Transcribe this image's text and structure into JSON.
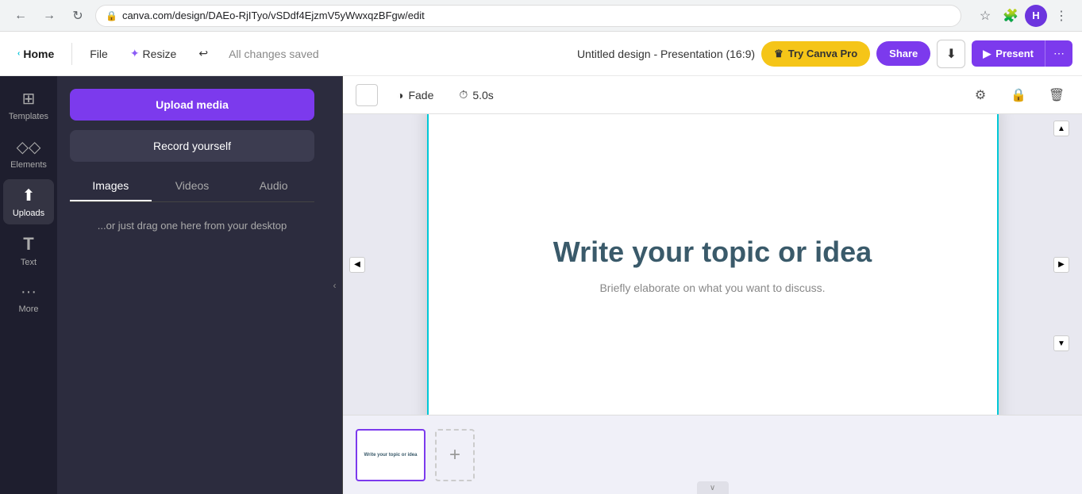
{
  "browser": {
    "back_label": "←",
    "forward_label": "→",
    "reload_label": "↻",
    "url": "canva.com/design/DAEo-RjITyo/vSDdf4EjzmV5yWwxqzBFgw/edit",
    "star_label": "☆",
    "extensions_label": "🧩",
    "avatar_label": "H",
    "menu_label": "⋮"
  },
  "header": {
    "home_label": "Home",
    "home_chevron": "‹",
    "file_label": "File",
    "magic_icon": "✦",
    "resize_label": "Resize",
    "undo_label": "↩",
    "saved_text": "All changes saved",
    "title": "Untitled design - Presentation (16:9)",
    "crown_icon": "♛",
    "try_pro_label": "Try Canva Pro",
    "share_label": "Share",
    "download_icon": "⬇",
    "present_icon": "▶",
    "present_label": "Present",
    "more_label": "⋯"
  },
  "sidebar": {
    "items": [
      {
        "id": "templates",
        "icon": "⊞",
        "label": "Templates"
      },
      {
        "id": "elements",
        "icon": "◇",
        "label": "Elements"
      },
      {
        "id": "uploads",
        "icon": "⬆",
        "label": "Uploads"
      },
      {
        "id": "text",
        "icon": "T",
        "label": "Text"
      },
      {
        "id": "more",
        "icon": "•••",
        "label": "More"
      }
    ]
  },
  "panel": {
    "upload_btn_label": "Upload media",
    "record_btn_label": "Record yourself",
    "tabs": [
      {
        "id": "images",
        "label": "Images",
        "active": true
      },
      {
        "id": "videos",
        "label": "Videos",
        "active": false
      },
      {
        "id": "audio",
        "label": "Audio",
        "active": false
      }
    ],
    "drag_hint": "...or just drag one here from\nyour desktop"
  },
  "slide_toolbar": {
    "fade_label": "Fade",
    "time_label": "5.0s",
    "fade_icon": "◑",
    "time_icon": "⏱",
    "filter_icon": "⚙",
    "lock_icon": "🔒",
    "delete_icon": "🗑"
  },
  "slide": {
    "main_title": "Write your topic or idea",
    "subtitle": "Briefly elaborate on what you want to discuss."
  },
  "bottom": {
    "add_slide_label": "+",
    "expand_label": "∨",
    "slide_thumb_text": "Write your topic or idea"
  },
  "collapse": {
    "arrow_label": "‹"
  }
}
